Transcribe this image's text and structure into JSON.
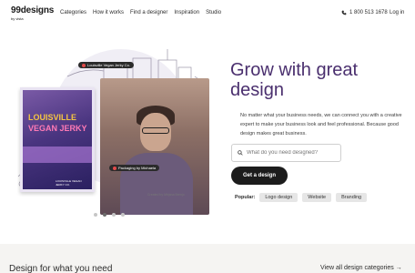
{
  "brand": {
    "logo": "99designs",
    "sub": "by vista"
  },
  "nav": {
    "items": [
      "Categories",
      "How it works",
      "Find a designer",
      "Inspiration",
      "Studio"
    ]
  },
  "header": {
    "phone": "1 800 513 1678",
    "login": "Log in"
  },
  "hero": {
    "title": "Grow with great design",
    "description": "No matter what your business needs, we can connect you with a creative expert to make your business look and feel professional. Because good design makes great business.",
    "search_placeholder": "What do you need designed?",
    "cta": "Get a design",
    "popular_label": "Popular:",
    "popular_chips": [
      "Logo design",
      "Website",
      "Branding"
    ]
  },
  "carousel": {
    "count": 4,
    "active": 2
  },
  "illustration": {
    "poster_line1": "LOUISVILLE",
    "poster_line2": "VEGAN JERKY",
    "poster_foot": "LOUISVILLE VEGAN JERKY CO.",
    "tag_top": "Louisville Vegan Jerky Co.",
    "tag_bottom": "Packaging by Michaela",
    "credit": "Created by Mirjana Brenjo"
  },
  "section": {
    "title": "Design for what you need",
    "link": "View all design categories"
  }
}
